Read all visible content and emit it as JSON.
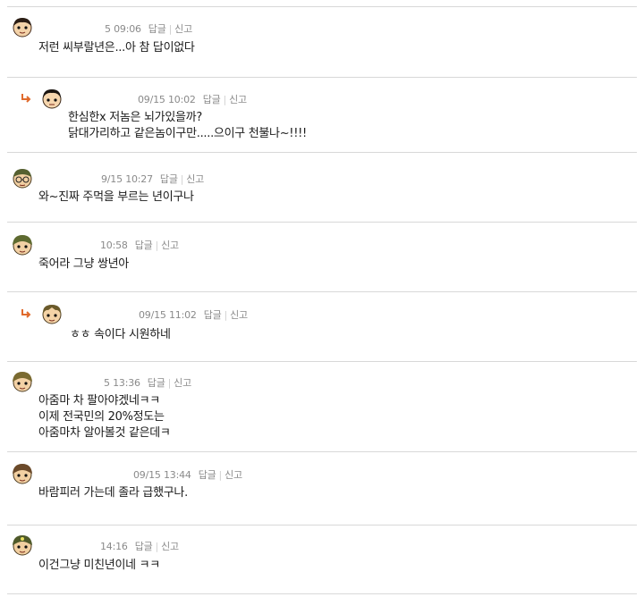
{
  "labels": {
    "reply": "답글",
    "report": "신고"
  },
  "comments": [
    {
      "time": "5 09:06",
      "is_reply": false,
      "text": [
        "저런 씨부랄년은...아 참 답이없다"
      ]
    },
    {
      "time": "09/15 10:02",
      "is_reply": true,
      "text": [
        "한심한x 저놈은 뇌가있을까?",
        "닭대가리하고 같은놈이구만.....으이구 천불나~!!!!"
      ]
    },
    {
      "time": "9/15 10:27",
      "is_reply": false,
      "text": [
        "와~진짜 주먹을 부르는 년이구나"
      ]
    },
    {
      "time": "10:58",
      "is_reply": false,
      "text": [
        "죽어라 그냥 쌍년아"
      ]
    },
    {
      "time": "09/15 11:02",
      "is_reply": true,
      "text": [
        "ㅎㅎ 속이다 시원하네"
      ]
    },
    {
      "time": "5 13:36",
      "is_reply": false,
      "text": [
        "아줌마 차 팔아야겠네ㅋㅋ",
        "이제 전국민의 20%정도는",
        "아줌마차 알아볼것 같은데ㅋ"
      ]
    },
    {
      "time": "09/15 13:44",
      "is_reply": false,
      "text": [
        "바람피러 가는데 졸라 급했구나."
      ]
    },
    {
      "time": "14:16",
      "is_reply": false,
      "text": [
        "이건그냥 미친년이네 ㅋㅋ"
      ]
    }
  ],
  "colors": {
    "reply_arrow": "#e06a2c",
    "meta_text": "#8a8a8a",
    "separator": "#d8d8d8"
  }
}
